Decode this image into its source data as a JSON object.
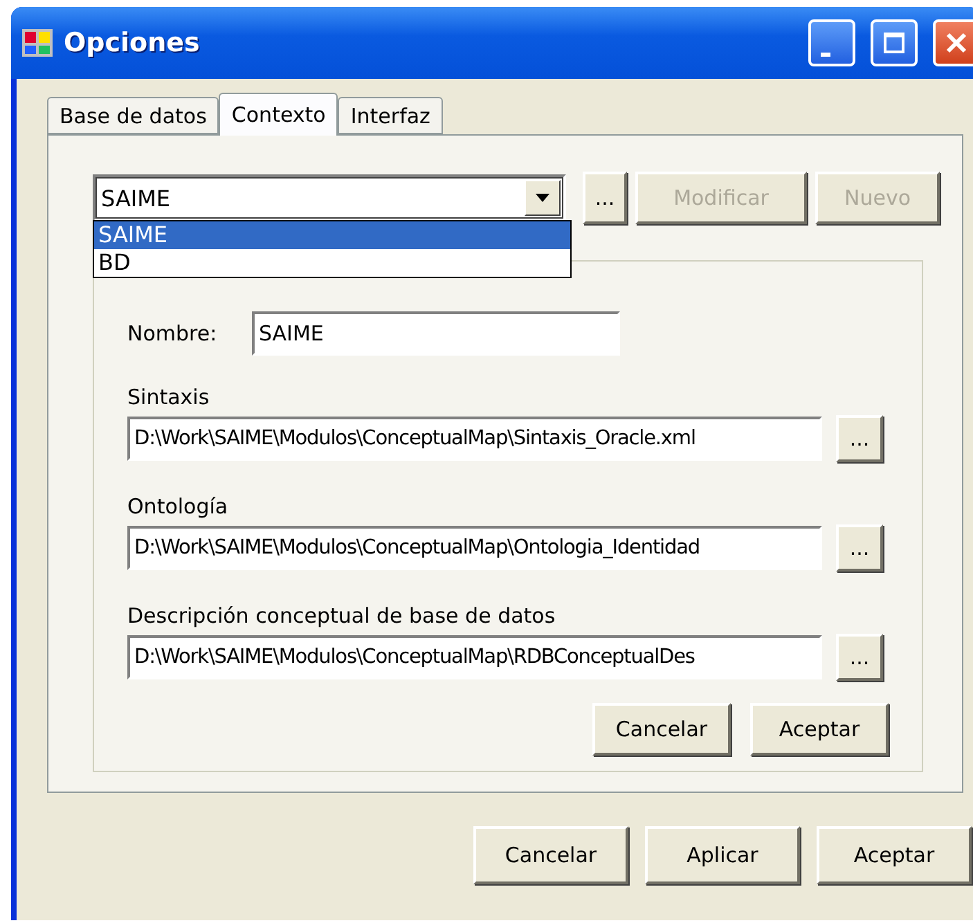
{
  "window": {
    "title": "Opciones"
  },
  "tabs": [
    {
      "label": "Base de datos",
      "selected": false
    },
    {
      "label": "Contexto",
      "selected": true
    },
    {
      "label": "Interfaz",
      "selected": false
    }
  ],
  "context": {
    "value": "SAIME",
    "expanded": true,
    "options": [
      {
        "label": "SAIME",
        "selected": true
      },
      {
        "label": "BD",
        "selected": false
      }
    ],
    "buttons": [
      {
        "label": "...",
        "disabled": false
      },
      {
        "label": "Modificar",
        "disabled": true
      },
      {
        "label": "Nuevo",
        "disabled": true
      }
    ]
  },
  "name": {
    "label": "Nombre:",
    "value": "SAIME"
  },
  "paths": [
    {
      "label": "Sintaxis",
      "value": "D:\\Work\\SAIME\\Modulos\\ConceptualMap\\Sintaxis_Oracle.xml",
      "button": "..."
    },
    {
      "label": "Ontología",
      "value": "D:\\Work\\SAIME\\Modulos\\ConceptualMap\\Ontologia_Identidad",
      "button": "..."
    },
    {
      "label": "Descripción conceptual de base de datos",
      "value": "D:\\Work\\SAIME\\Modulos\\ConceptualMap\\RDBConceptualDes",
      "button": "..."
    }
  ],
  "group_buttons": [
    "Cancelar",
    "Aceptar"
  ],
  "footer_buttons": [
    "Cancelar",
    "Aplicar",
    "Aceptar"
  ]
}
